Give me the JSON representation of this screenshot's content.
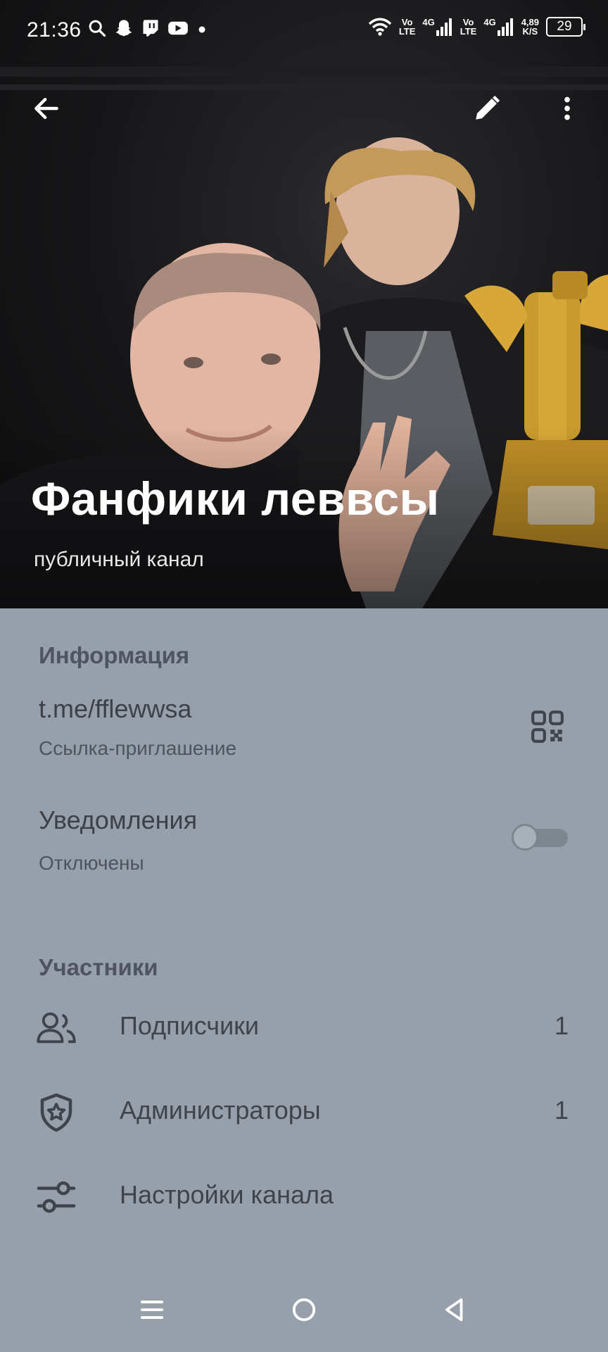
{
  "statusbar": {
    "time": "21:36",
    "left_icons": [
      "search-icon",
      "snapchat-icon",
      "twitch-icon",
      "youtube-icon",
      "dot-icon"
    ],
    "volte1_top": "Vo",
    "volte1_bottom": "LTE",
    "net1": "4G",
    "volte2_top": "Vo",
    "volte2_bottom": "LTE",
    "net2": "4G",
    "speed_top": "4,89",
    "speed_bottom": "K/S",
    "battery": "29"
  },
  "header": {
    "title": "Фанфики леввсы",
    "subtitle": "публичный канал",
    "back_icon": "arrow-left-icon",
    "edit_icon": "pencil-icon",
    "menu_icon": "more-vertical-icon"
  },
  "info": {
    "section_title": "Информация",
    "link": "t.me/fflewwsa",
    "link_caption": "Ссылка-приглашение",
    "qr_icon": "qr-code-icon",
    "notifications_label": "Уведомления",
    "notifications_state": "Отключены",
    "notifications_enabled": false
  },
  "members": {
    "section_title": "Участники",
    "items": [
      {
        "icon": "users-icon",
        "label": "Подписчики",
        "count": "1"
      },
      {
        "icon": "shield-star-icon",
        "label": "Администраторы",
        "count": "1"
      },
      {
        "icon": "sliders-icon",
        "label": "Настройки канала",
        "count": ""
      }
    ]
  },
  "navbar": {
    "icons": [
      "menu-lines-icon",
      "home-circle-icon",
      "back-triangle-icon"
    ]
  },
  "colors": {
    "panel_bg": "#97a0aa",
    "text_primary": "#3f444c",
    "section_title": "#4e5560"
  }
}
